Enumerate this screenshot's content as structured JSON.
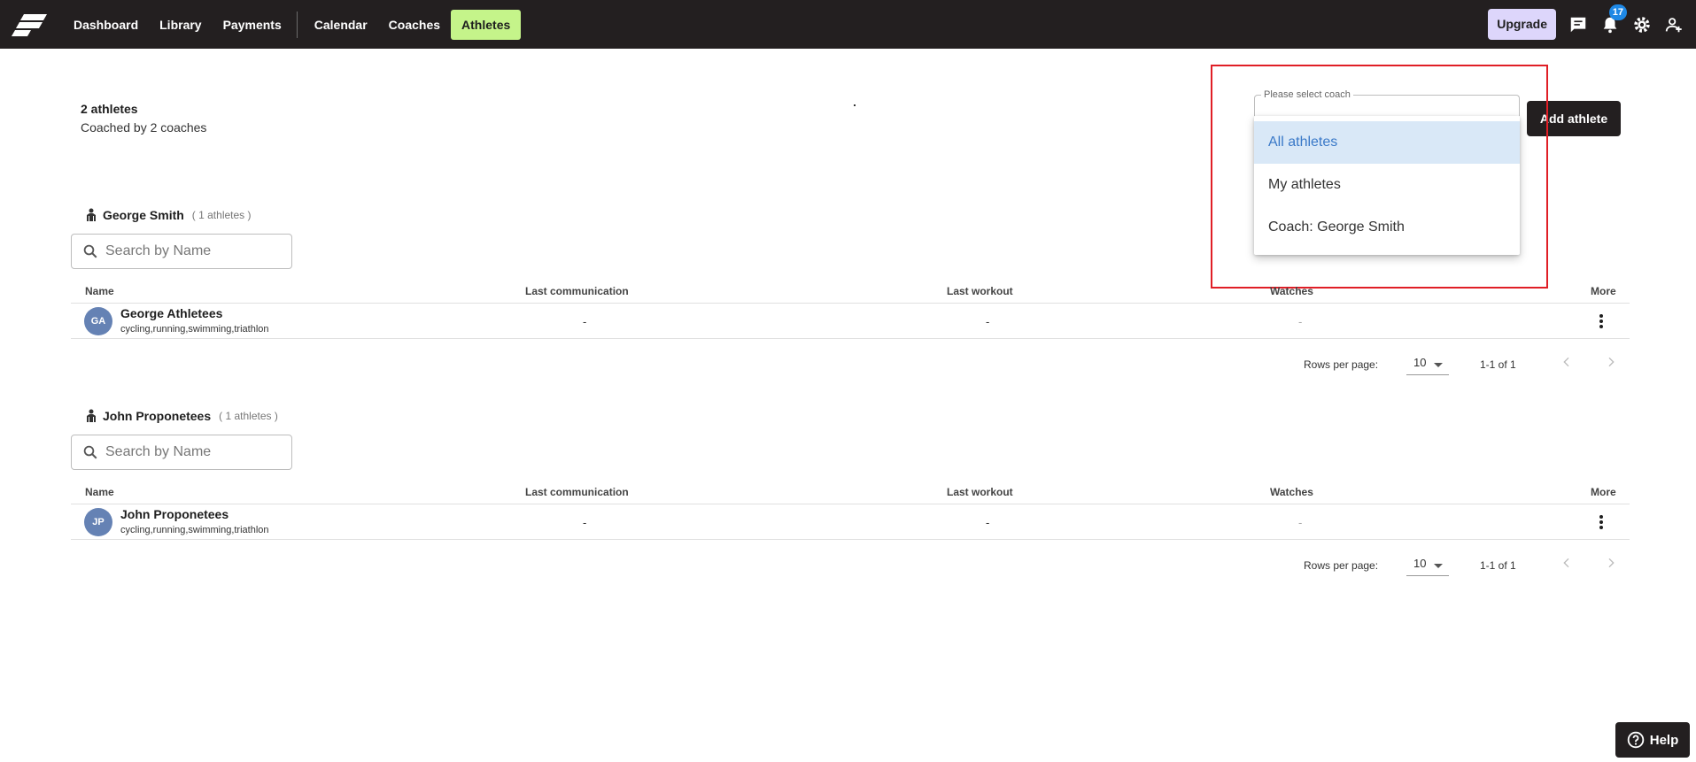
{
  "nav": {
    "items": [
      {
        "label": "Dashboard"
      },
      {
        "label": "Library"
      },
      {
        "label": "Payments"
      },
      {
        "label": "Calendar"
      },
      {
        "label": "Coaches"
      },
      {
        "label": "Athletes",
        "active": true
      }
    ],
    "upgrade_label": "Upgrade",
    "notification_count": "17",
    "icons": [
      "logo-icon",
      "chat-icon",
      "bell-icon",
      "gear-icon",
      "add-user-icon"
    ]
  },
  "summary": {
    "athlete_count": "2 athletes",
    "coached_by": "Coached by 2 coaches"
  },
  "coach_select": {
    "label": "Please select coach",
    "options": [
      "All athletes",
      "My athletes",
      "Coach: George Smith"
    ],
    "selected_index": 0
  },
  "add_athlete_label": "Add athlete",
  "columns": {
    "name": "Name",
    "last_communication": "Last communication",
    "last_workout": "Last workout",
    "watches": "Watches",
    "more": "More"
  },
  "groups": [
    {
      "coach": "George Smith",
      "count": "( 1 athletes )",
      "search_placeholder": "Search by Name",
      "rows": [
        {
          "initials": "GA",
          "name": "George Athletees",
          "sports": "cycling,running,swimming,triathlon",
          "last_communication": "-",
          "last_workout": "-",
          "watches": "-"
        }
      ],
      "pager": {
        "rows_per_page_label": "Rows per page:",
        "rows_per_page": "10",
        "range": "1-1 of 1"
      }
    },
    {
      "coach": "John Proponetees",
      "count": "( 1 athletes )",
      "search_placeholder": "Search by Name",
      "rows": [
        {
          "initials": "JP",
          "name": "John Proponetees",
          "sports": "cycling,running,swimming,triathlon",
          "last_communication": "-",
          "last_workout": "-",
          "watches": "-"
        }
      ],
      "pager": {
        "rows_per_page_label": "Rows per page:",
        "rows_per_page": "10",
        "range": "1-1 of 1"
      }
    }
  ],
  "help_label": "Help",
  "colors": {
    "topbar": "#231f20",
    "active_nav": "#c5f48a",
    "upgrade": "#ddd6fb",
    "badge": "#1e88e5",
    "avatar": "#6582b4",
    "selected_option_bg": "#d9e8f7",
    "selected_option_text": "#3a79c8",
    "highlight_border": "#e01e26"
  }
}
